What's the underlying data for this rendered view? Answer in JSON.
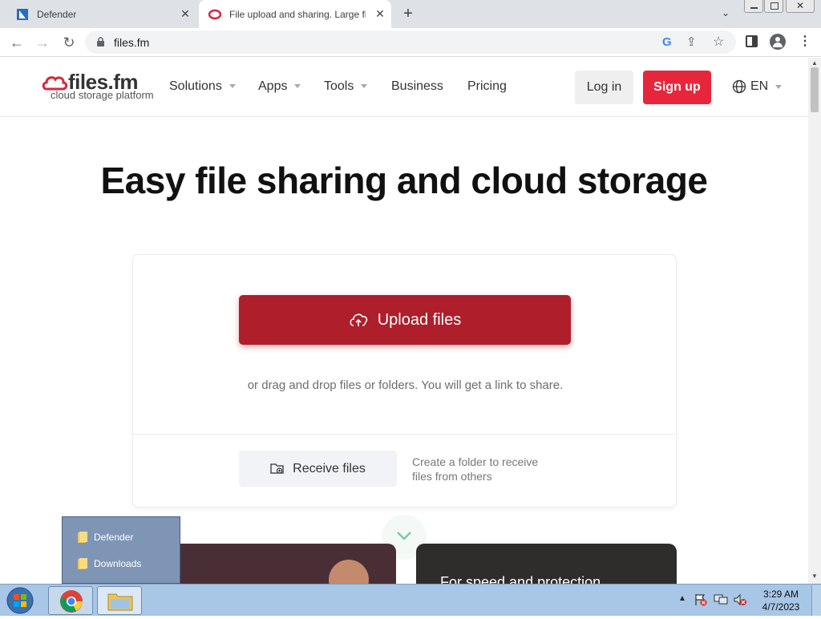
{
  "browser": {
    "tabs": [
      {
        "title": "Defender",
        "active": false
      },
      {
        "title": "File upload and sharing. Large fil",
        "active": true
      }
    ],
    "url": "files.fm"
  },
  "site": {
    "logo_name": "files.fm",
    "logo_tagline": "cloud storage platform",
    "nav": {
      "solutions": "Solutions",
      "apps": "Apps",
      "tools": "Tools",
      "business": "Business",
      "pricing": "Pricing"
    },
    "login_label": "Log in",
    "signup_label": "Sign up",
    "language": "EN",
    "accent_color": "#e8263b"
  },
  "main": {
    "title": "Easy file sharing and cloud storage",
    "upload_label": "Upload files",
    "drop_hint": "or drag and drop files or folders. You will get a link to share.",
    "receive_label": "Receive files",
    "receive_desc": "Create a folder to receive files from others",
    "promo2_text": "For speed and protection"
  },
  "jumplist": {
    "items": [
      {
        "label": "Defender",
        "icon": "folder-icon"
      },
      {
        "label": "Downloads",
        "icon": "folder-icon"
      }
    ]
  },
  "taskbar": {
    "time": "3:29 AM",
    "date": "4/7/2023"
  }
}
